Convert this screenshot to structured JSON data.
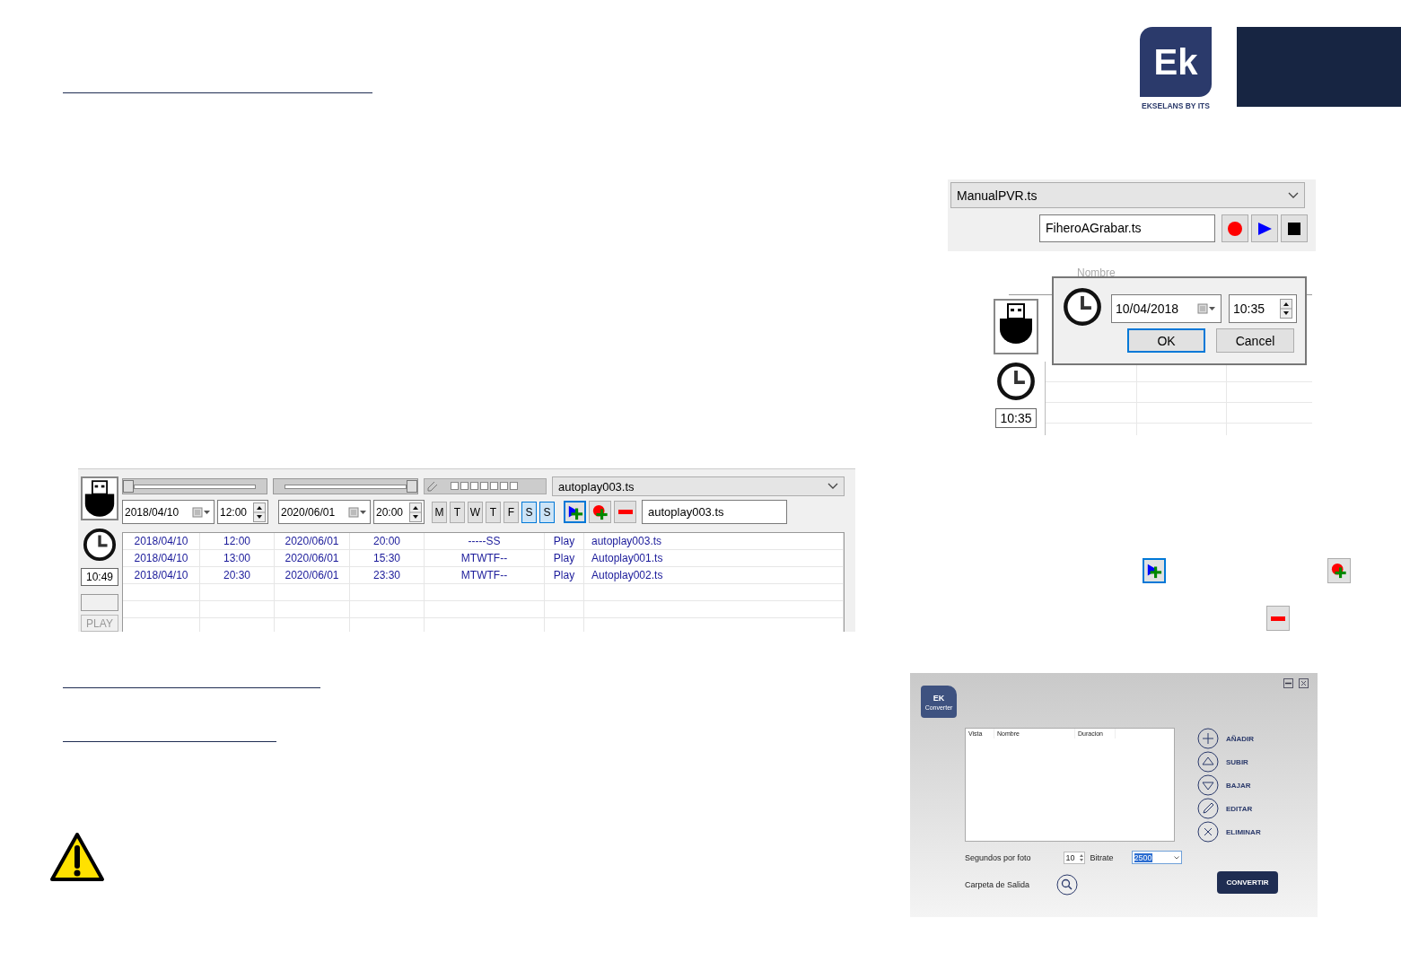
{
  "logo": {
    "mark": "Ek",
    "caption": "EKSELANS BY ITS"
  },
  "recorder": {
    "file_dropdown": "ManualPVR.ts",
    "filename_field": "FiheroAGrabar.ts",
    "buttons": [
      {
        "kind": "record"
      },
      {
        "kind": "play"
      },
      {
        "kind": "stop"
      }
    ]
  },
  "time_dialog": {
    "column_header": "Nombre",
    "date": "10/04/2018",
    "time": "10:35",
    "ok": {
      "label": "OK",
      "selected": true
    },
    "cancel": {
      "label": "Cancel",
      "selected": false
    },
    "side_clock": "10:35"
  },
  "scheduler": {
    "sliders": [
      {
        "level": 0
      },
      {
        "level": 1
      }
    ],
    "file_dropdown": "autoplay003.ts",
    "start_date": "2018/04/10",
    "start_time": "12:00",
    "end_date": "2020/06/01",
    "end_time": "20:00",
    "days": [
      {
        "label": "M",
        "selected": false
      },
      {
        "label": "T",
        "selected": false
      },
      {
        "label": "W",
        "selected": false
      },
      {
        "label": "T",
        "selected": false
      },
      {
        "label": "F",
        "selected": false
      },
      {
        "label": "S",
        "selected": true
      },
      {
        "label": "S",
        "selected": true
      }
    ],
    "actions": [
      {
        "kind": "add-play",
        "selected": true
      },
      {
        "kind": "add-record",
        "selected": false
      },
      {
        "kind": "remove",
        "selected": false
      }
    ],
    "filename_field": "autoplay003.ts",
    "clock": "10:49",
    "play_button": "PLAY",
    "rows": [
      [
        "2018/04/10",
        "12:00",
        "2020/06/01",
        "20:00",
        "-----SS",
        "Play",
        "autoplay003.ts"
      ],
      [
        "2018/04/10",
        "13:00",
        "2020/06/01",
        "15:30",
        "MTWTF--",
        "Play",
        "Autoplay001.ts"
      ],
      [
        "2018/04/10",
        "20:30",
        "2020/06/01",
        "23:30",
        "MTWTF--",
        "Play",
        "Autoplay002.ts"
      ]
    ]
  },
  "hint_icons": [
    {
      "kind": "add-play"
    },
    {
      "kind": "add-record"
    },
    {
      "kind": "remove"
    }
  ],
  "converter": {
    "logo": {
      "mark": "EK",
      "caption": "Converter"
    },
    "columns": [
      "Vista",
      "Nombre",
      "Duracion"
    ],
    "actions": [
      {
        "kind": "add",
        "label": "AÑADIR"
      },
      {
        "kind": "up",
        "label": "SUBIR"
      },
      {
        "kind": "down",
        "label": "BAJAR"
      },
      {
        "kind": "edit",
        "label": "EDITAR"
      },
      {
        "kind": "delete",
        "label": "ELIMINAR"
      }
    ],
    "seconds_label": "Segundos por foto",
    "seconds_value": "10",
    "bitrate_label": "Bitrate",
    "bitrate_value": "2500",
    "output_label": "Carpeta de Salida",
    "convert_button": "CONVERTIR"
  }
}
